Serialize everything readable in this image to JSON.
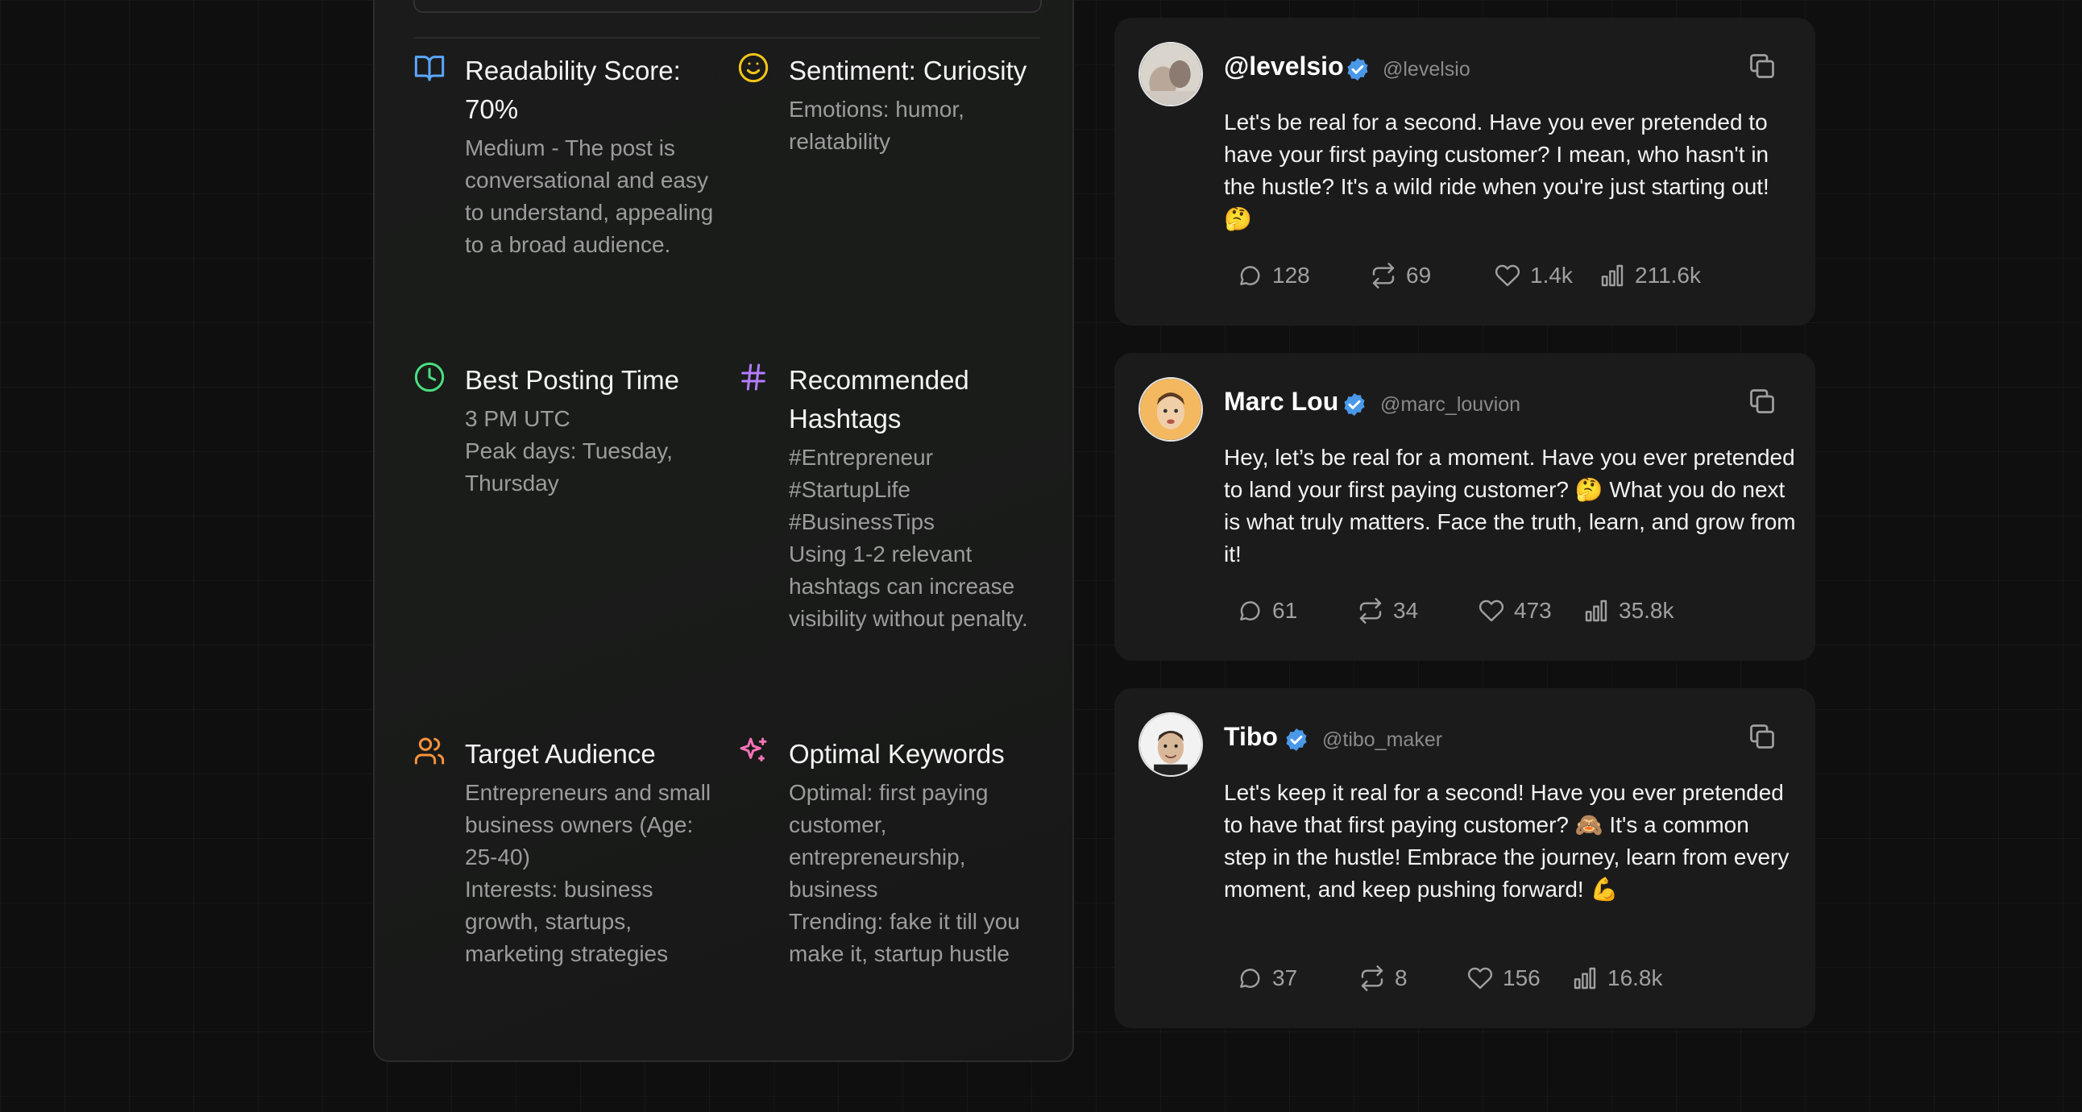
{
  "insights": [
    {
      "icon": "book-icon",
      "color": "#5aa7ff",
      "title": "Readability Score: 70%",
      "lines": [
        "Medium - The post is conversational and easy to understand, appealing to a broad audience."
      ]
    },
    {
      "icon": "smile-icon",
      "color": "#f5c518",
      "title": "Sentiment: Curiosity",
      "lines": [
        "Emotions: humor, relatability"
      ]
    },
    {
      "icon": "clock-icon",
      "color": "#4ade80",
      "title": "Best Posting Time",
      "lines": [
        "3 PM UTC",
        "Peak days: Tuesday, Thursday"
      ]
    },
    {
      "icon": "hash-icon",
      "color": "#b57cff",
      "title": "Recommended Hashtags",
      "lines": [
        "#Entrepreneur",
        "#StartupLife",
        "#BusinessTips",
        "Using 1-2 relevant hashtags can increase visibility without penalty."
      ]
    },
    {
      "icon": "users-icon",
      "color": "#fb923c",
      "title": "Target Audience",
      "lines": [
        "Entrepreneurs and small business owners (Age: 25-40)",
        "Interests: business growth, startups, marketing strategies"
      ]
    },
    {
      "icon": "sparkles-icon",
      "color": "#f472b6",
      "title": "Optimal Keywords",
      "lines": [
        "Optimal: first paying customer, entrepreneurship, business",
        "Trending: fake it till you make it, startup hustle"
      ]
    }
  ],
  "posts": [
    {
      "name": "@levelsio",
      "handle": "@levelsio",
      "text": "Let's be real for a second. Have you ever pretended to have your first paying customer? I mean, who hasn't in the hustle? It's a wild ride when you're just starting out! 🤔",
      "replies": "128",
      "reposts": "69",
      "likes": "1.4k",
      "views": "211.6k"
    },
    {
      "name": "Marc Lou",
      "handle": "@marc_louvion",
      "text": "Hey, let’s be real for a moment. Have you ever pretended to land your first paying customer? 🤔 What you do next is what truly matters. Face the truth, learn, and grow from it!",
      "replies": "61",
      "reposts": "34",
      "likes": "473",
      "views": "35.8k"
    },
    {
      "name": "Tibo",
      "handle": "@tibo_maker",
      "text": "Let's keep it real for a second! Have you ever pretended to have that first paying customer? 🙈 It's a common step in the hustle! Embrace the journey, learn from every moment, and keep pushing forward! 💪",
      "replies": "37",
      "reposts": "8",
      "likes": "156",
      "views": "16.8k"
    }
  ],
  "colors": {
    "verified": "#4a99e9",
    "muted": "#a0a0a0",
    "background": "#0f0f0f",
    "card": "#1b1b1b"
  }
}
